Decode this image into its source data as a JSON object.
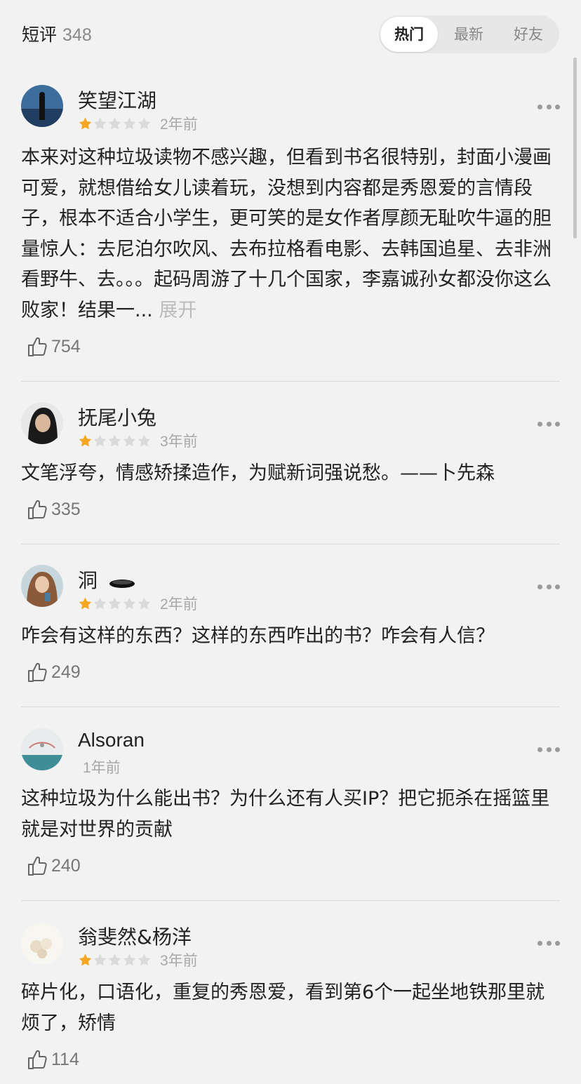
{
  "header": {
    "title": "短评",
    "count": "348"
  },
  "tabs": [
    {
      "label": "热门",
      "active": true
    },
    {
      "label": "最新",
      "active": false
    },
    {
      "label": "好友",
      "active": false
    }
  ],
  "colors": {
    "star_filled": "#f5a623",
    "star_empty": "#dadada",
    "background": "#f2f2f2"
  },
  "reviews": [
    {
      "user": "笑望江湖",
      "stars": 1,
      "time": "2年前",
      "text": "本来对这种垃圾读物不感兴趣，但看到书名很特别，封面小漫画可爱，就想借给女儿读着玩，没想到内容都是秀恩爱的言情段子，根本不适合小学生，更可笑的是女作者厚颜无耻吹牛逼的胆量惊人：去尼泊尔吹风、去布拉格看电影、去韩国追星、去非洲看野牛、去。。。起码周游了十几个国家，李嘉诚孙女都没你这么败家！结果一...",
      "expand": "展开",
      "likes": "754"
    },
    {
      "user": "抚尾小兔",
      "stars": 1,
      "time": "3年前",
      "text": "文笔浮夸，情感矫揉造作，为赋新词强说愁。——卜先森",
      "likes": "335"
    },
    {
      "user": "洞",
      "stars": 1,
      "time": "2年前",
      "text": "咋会有这样的东西？这样的东西咋出的书？咋会有人信？",
      "likes": "249"
    },
    {
      "user": "Alsoran",
      "stars": 0,
      "time": "1年前",
      "text": "这种垃圾为什么能出书？为什么还有人买IP？把它扼杀在摇篮里就是对世界的贡献",
      "likes": "240"
    },
    {
      "user": "翁斐然&杨洋",
      "stars": 1,
      "time": "3年前",
      "text": "碎片化，口语化，重复的秀恩爱，看到第6个一起坐地铁那里就烦了，矫情",
      "likes": "114"
    }
  ]
}
